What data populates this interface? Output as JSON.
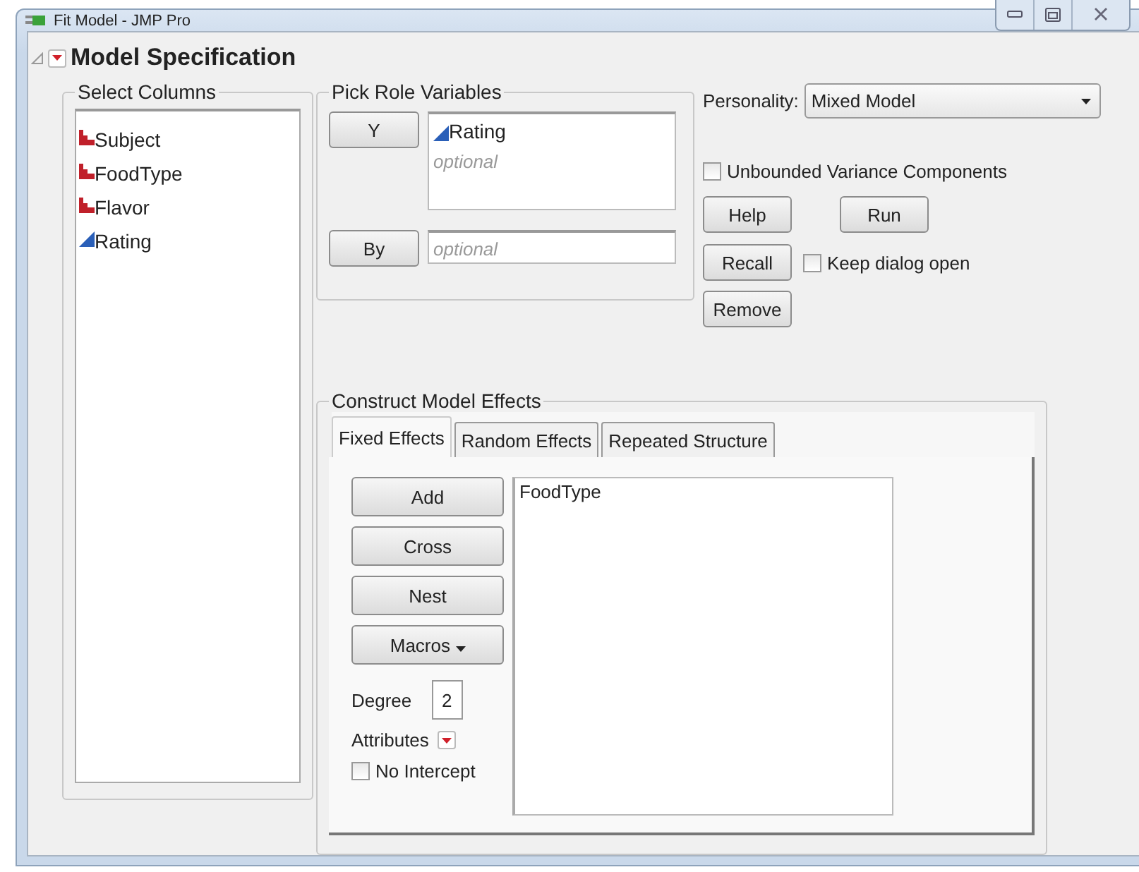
{
  "window": {
    "title": "Fit Model - JMP Pro"
  },
  "section": {
    "title": "Model Specification",
    "expanded": true
  },
  "select_columns": {
    "title": "Select Columns",
    "columns": [
      {
        "name": "Subject",
        "kind": "nominal"
      },
      {
        "name": "FoodType",
        "kind": "nominal"
      },
      {
        "name": "Flavor",
        "kind": "nominal"
      },
      {
        "name": "Rating",
        "kind": "continuous"
      }
    ]
  },
  "pick_role": {
    "title": "Pick Role Variables",
    "roles": [
      {
        "button": "Y",
        "kind": "list",
        "values": [
          {
            "name": "Rating",
            "kind": "continuous"
          }
        ],
        "placeholder": "optional"
      },
      {
        "button": "By",
        "kind": "field",
        "placeholder": "optional"
      }
    ]
  },
  "personality": {
    "label": "Personality:",
    "value": "Mixed Model"
  },
  "unbounded": {
    "label": "Unbounded Variance Components",
    "checked": false
  },
  "actions": {
    "help": "Help",
    "run": "Run",
    "recall": "Recall",
    "remove": "Remove"
  },
  "keep_open": {
    "label": "Keep dialog open",
    "checked": false
  },
  "construct": {
    "title": "Construct Model Effects",
    "tabs": [
      {
        "label": "Fixed Effects",
        "selected": true
      },
      {
        "label": "Random Effects",
        "selected": false
      },
      {
        "label": "Repeated Structure",
        "selected": false
      }
    ],
    "buttons": [
      "Add",
      "Cross",
      "Nest"
    ],
    "macros": "Macros",
    "degree": {
      "label": "Degree",
      "value": "2"
    },
    "attributes": "Attributes",
    "no_intercept": {
      "label": "No Intercept",
      "checked": false
    },
    "effects": [
      "FoodType"
    ]
  }
}
